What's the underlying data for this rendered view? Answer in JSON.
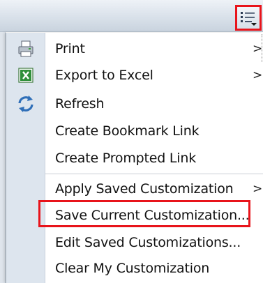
{
  "menu": {
    "items": [
      {
        "label": "Print",
        "icon": "printer-icon",
        "has_submenu": true
      },
      {
        "label": "Export to Excel",
        "icon": "excel-icon",
        "has_submenu": true
      },
      {
        "label": "Refresh",
        "icon": "refresh-icon",
        "has_submenu": false
      },
      {
        "label": "Create Bookmark Link",
        "icon": "",
        "has_submenu": false
      },
      {
        "label": "Create Prompted Link",
        "icon": "",
        "has_submenu": false
      },
      {
        "label": "Apply Saved Customization",
        "icon": "",
        "has_submenu": true
      },
      {
        "label": "Save Current Customization...",
        "icon": "",
        "has_submenu": false
      },
      {
        "label": "Edit Saved Customizations...",
        "icon": "",
        "has_submenu": false
      },
      {
        "label": "Clear My Customization",
        "icon": "",
        "has_submenu": false
      }
    ],
    "submenu_arrow": ">"
  },
  "toolbar": {
    "menu_button_icon": "page-options-icon"
  },
  "colors": {
    "highlight_border": "#e8141b",
    "gutter": "#dde5ee"
  }
}
